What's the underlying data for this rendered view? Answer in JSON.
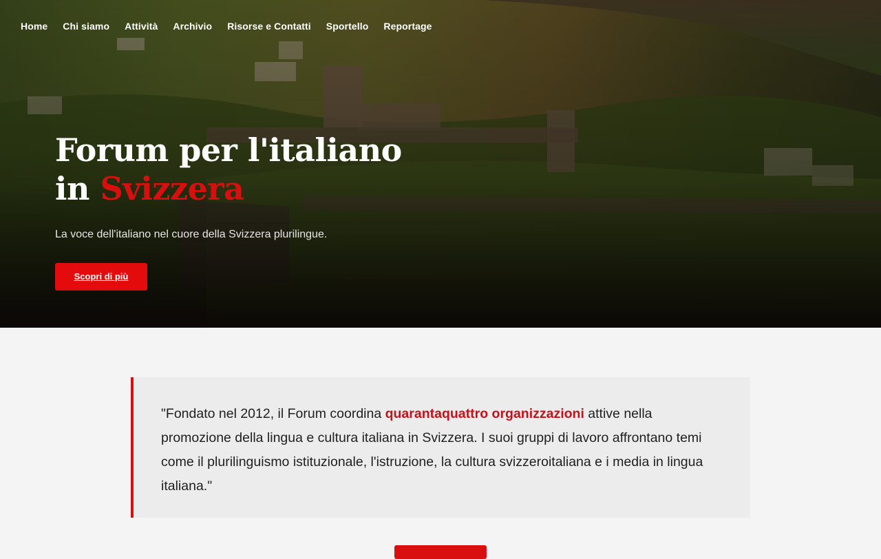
{
  "nav": {
    "items": [
      {
        "label": "Home"
      },
      {
        "label": "Chi siamo"
      },
      {
        "label": "Attività"
      },
      {
        "label": "Archivio"
      },
      {
        "label": "Risorse e Contatti"
      },
      {
        "label": "Sportello"
      },
      {
        "label": "Reportage"
      }
    ]
  },
  "hero": {
    "title_line1": "Forum per l'italiano",
    "title_in": "in ",
    "title_accent": "Svizzera",
    "subtitle": "La voce dell'italiano nel cuore della Svizzera plurilingue.",
    "cta_label": "Scopri di più"
  },
  "quote": {
    "part1": "\"Fondato nel 2012, il Forum coordina ",
    "highlight": "quarantaquattro organizzazioni",
    "part2": " attive nella promozione della lingua e cultura italiana in Svizzera. I suoi gruppi di lavoro affrontano temi come il plurilinguismo istituzionale, l'istruzione, la cultura svizzeroitaliana e i media in lingua italiana.\""
  },
  "colors": {
    "accent": "#e30b0b",
    "quote_border": "#d90f0f",
    "page_bg": "#f4f4f4"
  }
}
